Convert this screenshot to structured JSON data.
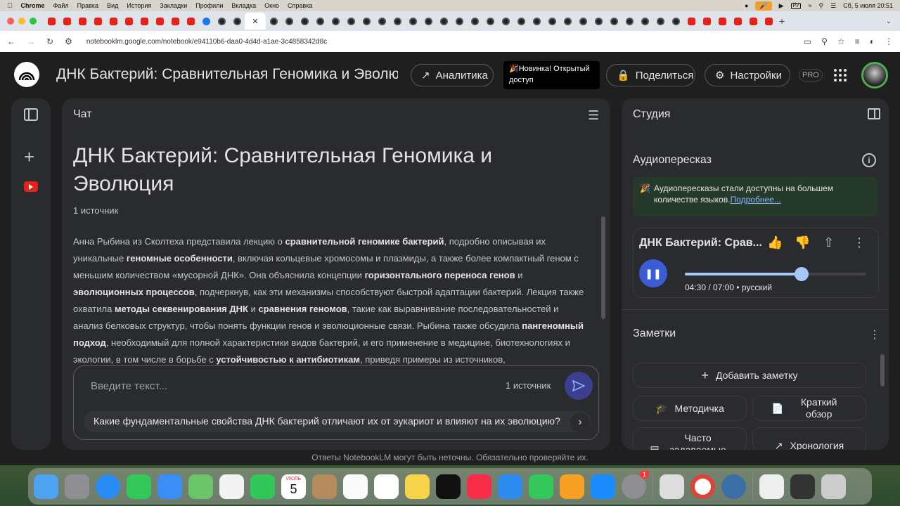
{
  "menubar": {
    "app": "Chrome",
    "items": [
      "Файл",
      "Правка",
      "Вид",
      "История",
      "Закладки",
      "Профили",
      "Вкладка",
      "Окно",
      "Справка"
    ],
    "lang": "РУ",
    "datetime": "Сб, 5 июля  20:51"
  },
  "browser": {
    "url": "notebooklm.google.com/notebook/e94110b6-daa0-4d4d-a1ae-3c4858342d8c"
  },
  "header": {
    "title": "ДНК Бактерий: Сравнительная Геномика и Эволюция",
    "analytics": "Аналитика",
    "new_badge": "🎉Новинка! Открытый доступ",
    "share": "Поделиться",
    "settings": "Настройки",
    "pro": "PRO"
  },
  "chat": {
    "panel_title": "Чат",
    "title": "ДНК Бактерий: Сравнительная Геномика и Эволюция",
    "sources": "1 источник",
    "summary": [
      {
        "t": "Анна Рыбина из Сколтеха представила лекцию о "
      },
      {
        "b": "сравнительной геномике бактерий"
      },
      {
        "t": ", подробно описывая их уникальные "
      },
      {
        "b": "геномные особенности"
      },
      {
        "t": ", включая кольцевые хромосомы и плазмиды, а также более компактный геном с меньшим количеством «мусорной ДНК». Она объяснила концепции "
      },
      {
        "b": "горизонтального переноса генов"
      },
      {
        "t": " и "
      },
      {
        "b": "эволюционных процессов"
      },
      {
        "t": ", подчеркнув, как эти механизмы способствуют быстрой адаптации бактерий. Лекция также охватила "
      },
      {
        "b": "методы секвенирования ДНК"
      },
      {
        "t": " и "
      },
      {
        "b": "сравнения геномов"
      },
      {
        "t": ", такие как выравнивание последовательностей и анализ белковых структур, чтобы понять функции генов и эволюционные связи. Рыбина также обсудила "
      },
      {
        "b": "пангеномный подход"
      },
      {
        "t": ", необходимый для полной характеристики видов бактерий, и его применение в медицине, биотехнологиях и экологии, в том числе в борьбе с "
      },
      {
        "b": "устойчивостью к антибиотикам"
      },
      {
        "t": ", приведя примеры из источников,"
      }
    ],
    "input_placeholder": "Введите текст...",
    "input_sources": "1 источник",
    "suggestion": "Какие фундаментальные свойства ДНК бактерий отличают их от эукариот и влияют на их эволюцию?"
  },
  "studio": {
    "panel_title": "Студия",
    "audio_heading": "Аудиопересказ",
    "banner_text": "Аудиопересказы стали доступны на большем количестве языков.",
    "banner_link": "Подробнее...",
    "audio_title": "ДНК Бактерий: Срав...",
    "audio_time": "04:30 / 07:00 • русский",
    "progress": 0.643,
    "notes_heading": "Заметки",
    "add_note": "Добавить заметку",
    "study_guide": "Методичка",
    "briefing": "Краткий обзор",
    "faq": "Часто задаваемые",
    "timeline": "Хронология"
  },
  "footer": "Ответы NotebookLM могут быть неточны. Обязательно проверяйте их.",
  "dock": {
    "calendar_month": "ИЮЛЬ",
    "calendar_day": "5",
    "badge": "1"
  },
  "colors": {
    "accent": "#a8c7fa",
    "play": "#3c5bd6",
    "send": "#3c3f8f",
    "banner": "#263a2c"
  }
}
